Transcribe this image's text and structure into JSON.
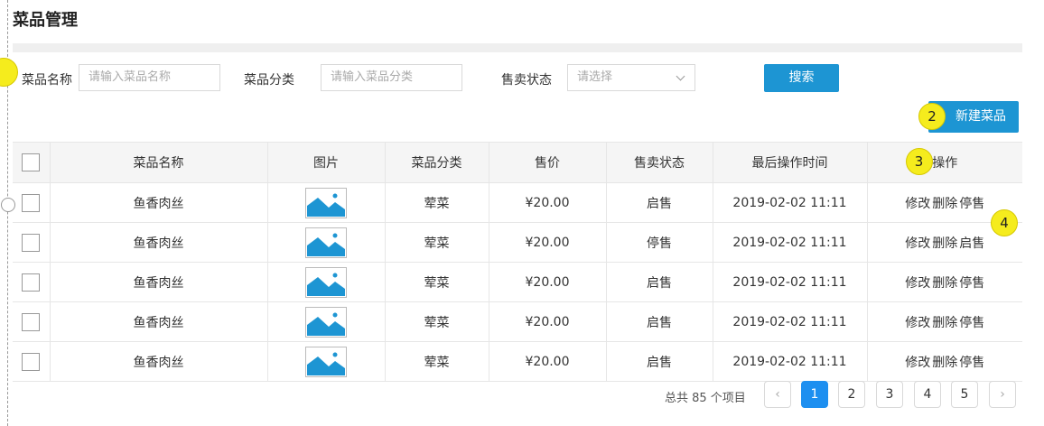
{
  "page": {
    "title": "菜品管理"
  },
  "filters": {
    "name_label": "菜品名称",
    "name_placeholder": "请输入菜品名称",
    "category_label": "菜品分类",
    "category_placeholder": "请输入菜品分类",
    "status_label": "售卖状态",
    "status_placeholder": "请选择",
    "search_label": "搜索"
  },
  "toolbar": {
    "new_label": "新建菜品"
  },
  "markers": [
    "2",
    "3",
    "4"
  ],
  "table": {
    "headers": [
      "菜品名称",
      "图片",
      "菜品分类",
      "售价",
      "售卖状态",
      "最后操作时间",
      "操作"
    ],
    "rows": [
      {
        "name": "鱼香肉丝",
        "category": "荤菜",
        "price": "¥20.00",
        "status": "启售",
        "time": "2019-02-02 11:11",
        "edit": "修改",
        "delete": "删除",
        "toggle": "停售"
      },
      {
        "name": "鱼香肉丝",
        "category": "荤菜",
        "price": "¥20.00",
        "status": "停售",
        "time": "2019-02-02 11:11",
        "edit": "修改",
        "delete": "删除",
        "toggle": "启售"
      },
      {
        "name": "鱼香肉丝",
        "category": "荤菜",
        "price": "¥20.00",
        "status": "启售",
        "time": "2019-02-02 11:11",
        "edit": "修改",
        "delete": "删除",
        "toggle": "停售"
      },
      {
        "name": "鱼香肉丝",
        "category": "荤菜",
        "price": "¥20.00",
        "status": "启售",
        "time": "2019-02-02 11:11",
        "edit": "修改",
        "delete": "删除",
        "toggle": "停售"
      },
      {
        "name": "鱼香肉丝",
        "category": "荤菜",
        "price": "¥20.00",
        "status": "启售",
        "time": "2019-02-02 11:11",
        "edit": "修改",
        "delete": "删除",
        "toggle": "停售"
      }
    ]
  },
  "pagination": {
    "total_text": "总共 85 个项目",
    "pages": [
      "1",
      "2",
      "3",
      "4",
      "5"
    ],
    "current": "1"
  },
  "colors": {
    "primary": "#1d95d3",
    "active_page": "#1d8ff0",
    "marker": "#f5ec1d"
  }
}
